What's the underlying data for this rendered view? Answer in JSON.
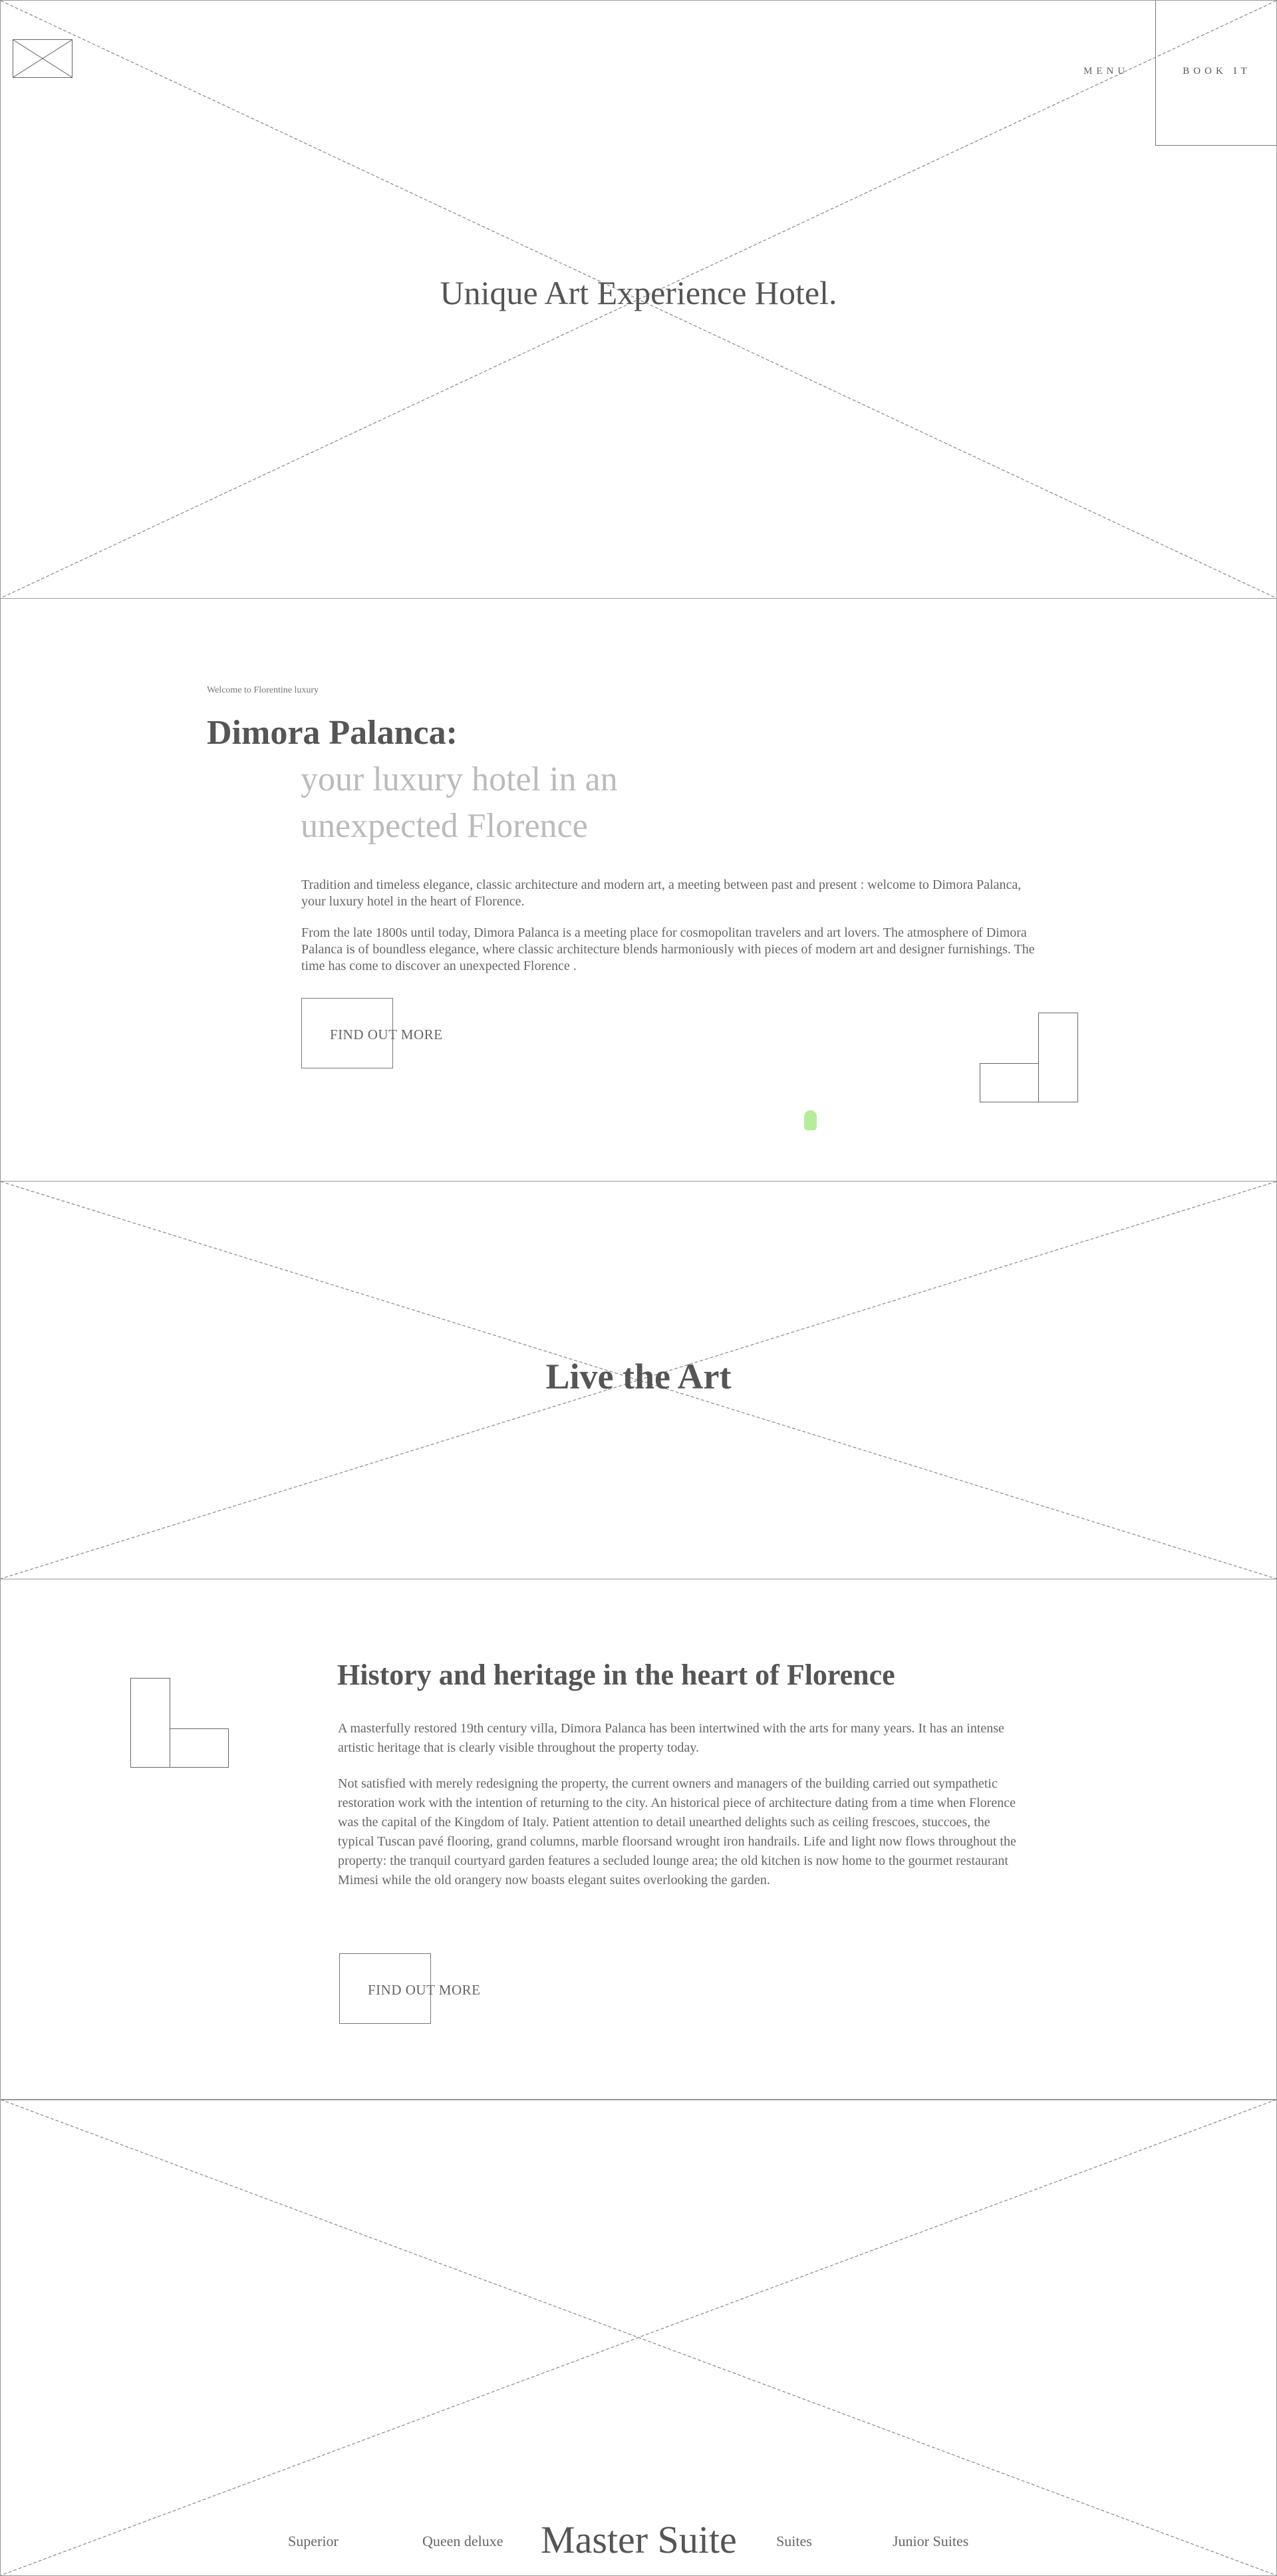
{
  "header": {
    "logo_icon": "image-placeholder-icon",
    "menu_label": "MENU",
    "book_label": "BOOK IT"
  },
  "hero": {
    "title": "Unique Art Experience Hotel."
  },
  "intro": {
    "kicker": "Welcome to Florentine luxury",
    "title": "Dimora Palanca:",
    "subtitle_line1": "your luxury hotel in an",
    "subtitle_line2": "unexpected Florence",
    "paragraph1": "Tradition and timeless elegance, classic architecture and modern art, a meeting between past and present : welcome to Dimora Palanca, your luxury hotel in the heart of Florence.",
    "paragraph2": "From the late 1800s until today, Dimora Palanca is a meeting place for cosmopolitan travelers and art lovers. The atmosphere of Dimora Palanca is of boundless elegance, where classic architecture blends harmoniously with pieces of modern art and designer furnishings. The time has come to discover an unexpected Florence .",
    "button_label": "FIND OUT MORE"
  },
  "live": {
    "title": "Live the Art"
  },
  "history": {
    "title": "History and heritage in the heart of Florence",
    "paragraph1": "A masterfully restored 19th century villa, Dimora Palanca has been intertwined with the arts for many years. It has an intense artistic heritage that is clearly visible throughout the property today.",
    "paragraph2": "Not satisfied with merely redesigning the property, the current owners and managers of the building carried out sympathetic restoration work with the intention of returning to the city. An historical piece of architecture dating from a time when Florence was the capital of the Kingdom of Italy. Patient attention to detail unearthed delights such as ceiling frescoes, stuccoes, the typical Tuscan pavé flooring, grand columns, marble floorsand wrought iron handrails. Life and light now flows throughout the property: the tranquil courtyard garden features a secluded lounge area; the old kitchen is now home to the gourmet restaurant Mimesi while the old orangery now boasts elegant suites overlooking the garden.",
    "button_label": "FIND OUT MORE"
  },
  "suites": {
    "tabs": [
      "Superior",
      "Queen deluxe",
      "Master Suite",
      "Suites",
      "Junior Suites"
    ],
    "active": "Master Suite"
  },
  "colors": {
    "accent_dot": "#b8ec9d",
    "muted_text": "#bbbbbb",
    "body_text": "#666666"
  }
}
